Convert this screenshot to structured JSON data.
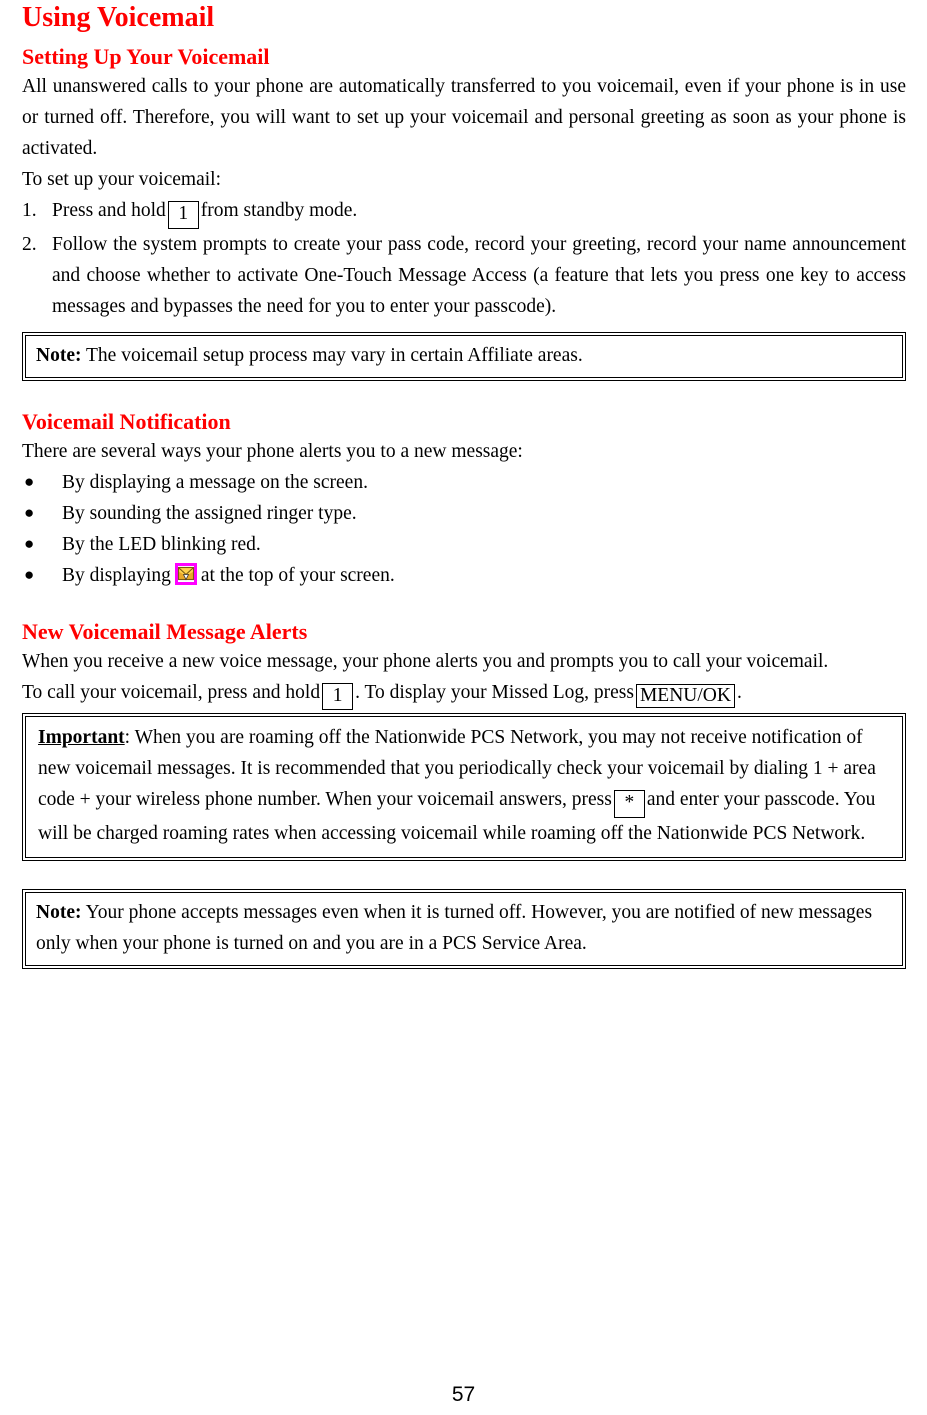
{
  "document": {
    "title": "Using Voicemail",
    "page_number": "57"
  },
  "sections": {
    "setup": {
      "heading": "Setting Up Your Voicemail",
      "intro": "All unanswered calls to your phone are automatically transferred to you voicemail, even if your phone is in use or turned off. Therefore, you will want to set up your voicemail and personal greeting as soon as your phone is activated.",
      "lead_in": "To set up your voicemail:",
      "steps": [
        {
          "num": "1.",
          "before": "Press and hold",
          "key": "1",
          "after": "from standby mode."
        },
        {
          "num": "2.",
          "text": "Follow the system prompts to create your pass code, record your greeting, record your name announcement and choose whether to activate One-Touch Message Access (a feature that lets you press one key to access messages and bypasses the need for you to enter your passcode)."
        }
      ],
      "note": {
        "label": "Note:",
        "text": " The voicemail setup process may vary in certain Affiliate areas."
      }
    },
    "notification": {
      "heading": "Voicemail Notification",
      "intro": "There are several ways your phone alerts you to a new message:",
      "bullets": [
        {
          "marker": "●",
          "text": "By displaying a message on the screen."
        },
        {
          "marker": "●",
          "text": "By sounding the assigned ringer type."
        },
        {
          "marker": "●",
          "text": "By the LED blinking red."
        },
        {
          "marker": "●",
          "text_before": "By displaying",
          "icon": "envelope-message-icon",
          "text_after": "at the top of your screen."
        }
      ]
    },
    "alerts": {
      "heading": "New Voicemail Message Alerts",
      "intro": "When you receive a new voice message, your phone alerts you and prompts you to call your voicemail.",
      "call_line": {
        "before": "To call your voicemail, press and hold",
        "key1": "1",
        "middle": ". To display your Missed Log, press",
        "key2": "MENU/OK",
        "after": "."
      },
      "important": {
        "label": "Important",
        "colon": ":",
        "text_part1": " When you are roaming off the Nationwide PCS Network, you may not receive notification of new voicemail messages. It is recommended that you periodically check your voicemail by dialing 1 + area code + your wireless phone number. When your voicemail answers, press",
        "key": "*",
        "text_part2": "and enter your passcode. You will be charged roaming rates when accessing voicemail while roaming off the Nationwide PCS Network."
      },
      "note": {
        "label": "Note:",
        "text": " Your phone accepts messages even when it is turned off. However, you are notified of new messages only when your phone is turned on and you are in a PCS Service Area."
      }
    }
  },
  "colors": {
    "heading_red": "#ff0000",
    "body_black": "#000000",
    "icon_border": "#ff00ff",
    "icon_fill": "#ffcc33"
  }
}
